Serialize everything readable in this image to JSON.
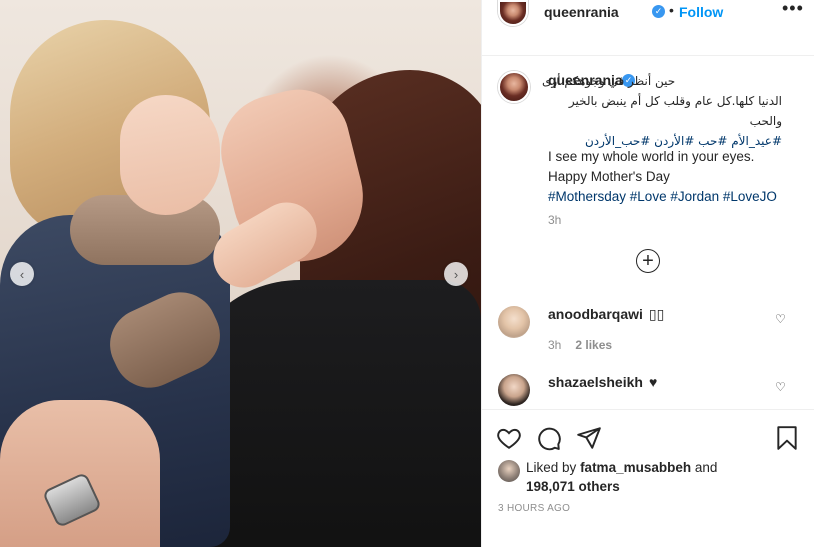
{
  "header": {
    "username": "queenrania",
    "verified_icon": "verified-badge-icon",
    "separator": "•",
    "follow_label": "Follow",
    "more_icon": "more-options-icon",
    "more_glyph": "•••"
  },
  "caption": {
    "username": "queenrania",
    "arabic_line1": "حين أنظر في وجوهكم أرى",
    "arabic_line2": "الدنيا كلها.كل عام وقلب كل أم ينبض بالخير والحب",
    "arabic_tags": "#عيد_الأم #حب #الأردن #حب_الأردن",
    "english_line1": "I see my whole world in your eyes.",
    "english_line2": "Happy Mother's Day",
    "english_tags": "#Mothersday #Love #Jordan #LoveJO",
    "time": "3h",
    "load_more_glyph": "+"
  },
  "comments": [
    {
      "username": "anoodbarqawi",
      "text": "▯▯",
      "time": "3h",
      "likes": "2 likes",
      "heart_glyph": "♡"
    },
    {
      "username": "shazaelsheikh",
      "text": "♥",
      "heart_glyph": "♡"
    }
  ],
  "actions": {
    "like_icon": "heart-icon",
    "comment_icon": "comment-bubble-icon",
    "share_icon": "paper-plane-icon",
    "save_icon": "bookmark-icon"
  },
  "liked_by": {
    "prefix": "Liked by",
    "user": "fatma_musabbeh",
    "conjunction": "and",
    "count": "198,071 others"
  },
  "date": "3 HOURS AGO",
  "carousel": {
    "prev_glyph": "‹",
    "next_glyph": "›"
  },
  "colors": {
    "accent": "#0095f6",
    "hashtag": "#00376b",
    "secondary_text": "#8e8e8e",
    "verified": "#3897f0"
  }
}
